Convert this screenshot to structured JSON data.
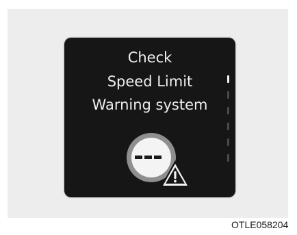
{
  "display": {
    "line1": "Check",
    "line2": "Speed Limit",
    "line3": "Warning system"
  },
  "scroll_indicator": {
    "segments": 6,
    "active_index": 0
  },
  "icons": {
    "speed_limit": "speed-limit-warning-icon",
    "warning": "warning-triangle-icon"
  },
  "colors": {
    "screen_bg": "#161616",
    "text": "#efefef",
    "panel_bg": "#ededed"
  },
  "caption": "OTLE058204"
}
